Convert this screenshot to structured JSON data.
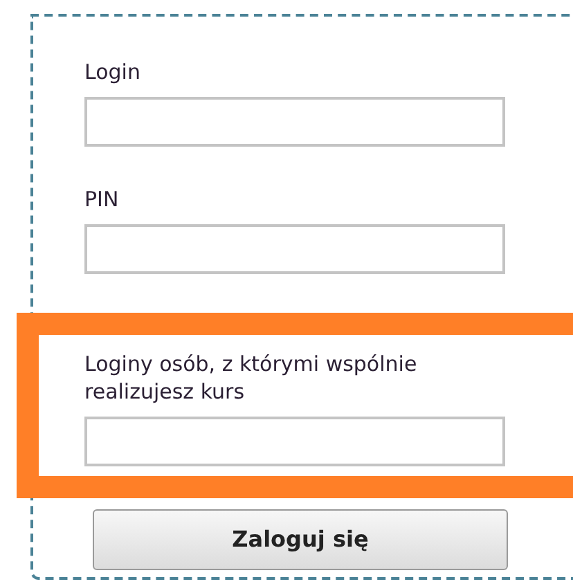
{
  "fields": [
    {
      "label": "Login",
      "highlighted": false
    },
    {
      "label": "PIN",
      "highlighted": false
    },
    {
      "label": "Loginy osób, z którymi wspólnie realizujesz kurs",
      "highlighted": true
    }
  ],
  "button": {
    "label": "Zaloguj się"
  }
}
